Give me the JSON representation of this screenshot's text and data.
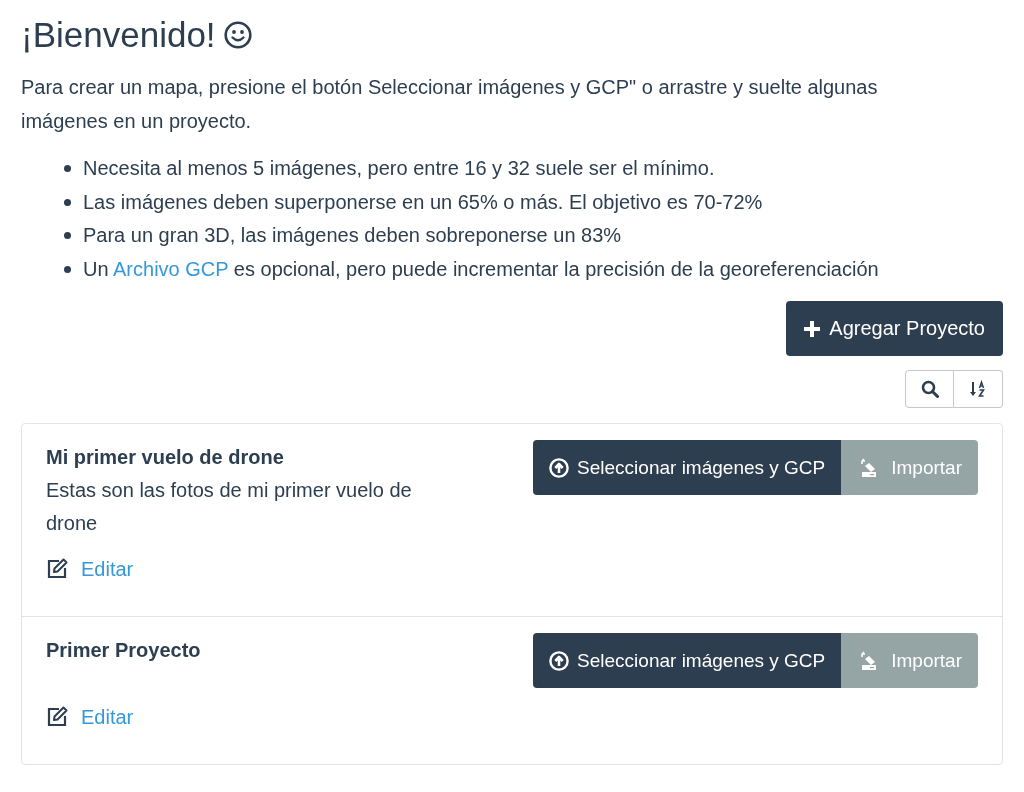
{
  "title": "¡Bienvenido!",
  "intro": "Para crear un mapa, presione el botón Seleccionar imágenes y GCP\" o arrastre y suelte algunas imágenes en un proyecto.",
  "tips": [
    {
      "parts": [
        {
          "kind": "text",
          "text": "Necesita al menos 5 imágenes, pero entre 16 y 32 suele ser el mínimo."
        }
      ]
    },
    {
      "parts": [
        {
          "kind": "text",
          "text": "Las imágenes deben superponerse en un 65% o más. El objetivo es 70-72%"
        }
      ]
    },
    {
      "parts": [
        {
          "kind": "text",
          "text": "Para un gran 3D, las imágenes deben sobreponerse un 83%"
        }
      ]
    },
    {
      "parts": [
        {
          "kind": "text",
          "text": "Un "
        },
        {
          "kind": "link",
          "text": "Archivo GCP"
        },
        {
          "kind": "text",
          "text": " es opcional, pero puede incrementar la precisión de la georeferenciación"
        }
      ]
    }
  ],
  "add_project_button": {
    "label": "Agregar Proyecto"
  },
  "projects": [
    {
      "name": "Mi primer vuelo de drone",
      "description": "Estas son las fotos de mi primer vuelo de drone",
      "select_button": "Seleccionar imágenes y GCP",
      "import_button": "Importar",
      "edit_link": "Editar"
    },
    {
      "name": "Primer Proyecto",
      "select_button": "Seleccionar imágenes y GCP",
      "import_button": "Importar",
      "edit_link": "Editar"
    }
  ]
}
